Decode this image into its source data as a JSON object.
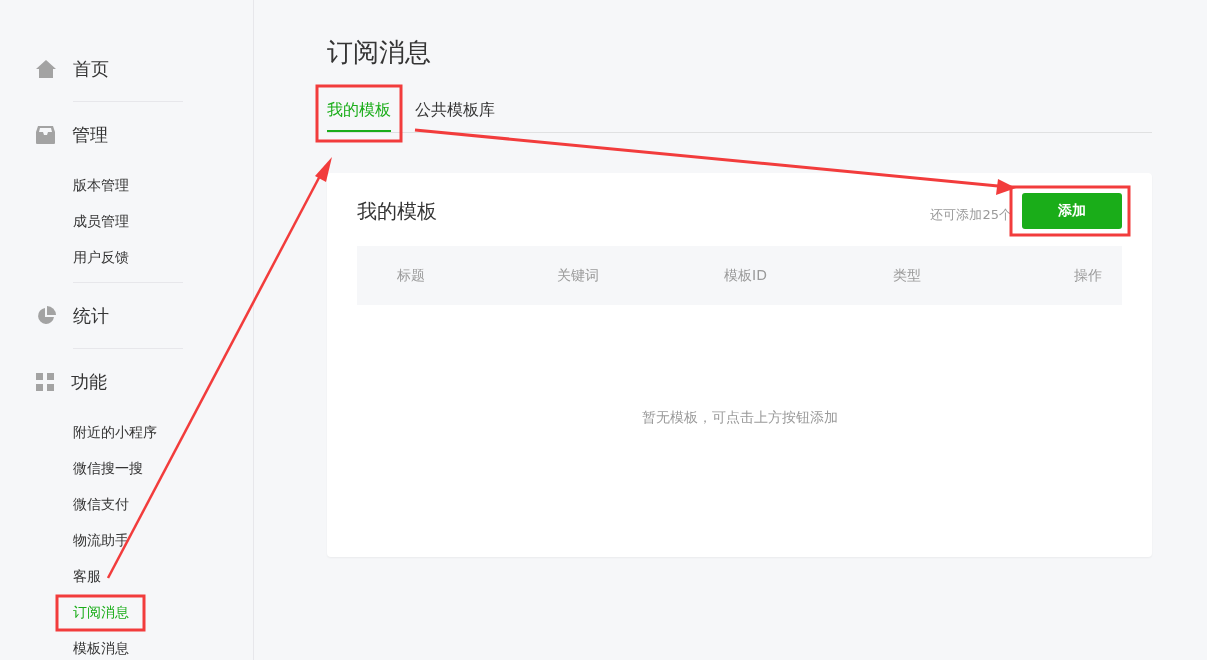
{
  "sidebar": {
    "groups": [
      {
        "kind": "home",
        "label": "首页"
      },
      {
        "kind": "inbox",
        "label": "管理",
        "children": [
          {
            "label": "版本管理",
            "selected": false
          },
          {
            "label": "成员管理",
            "selected": false
          },
          {
            "label": "用户反馈",
            "selected": false
          }
        ]
      },
      {
        "kind": "pie",
        "label": "统计"
      },
      {
        "kind": "grid",
        "label": "功能",
        "children": [
          {
            "label": "附近的小程序",
            "selected": false
          },
          {
            "label": "微信搜一搜",
            "selected": false
          },
          {
            "label": "微信支付",
            "selected": false
          },
          {
            "label": "物流助手",
            "selected": false
          },
          {
            "label": "客服",
            "selected": false
          },
          {
            "label": "订阅消息",
            "selected": true
          },
          {
            "label": "模板消息",
            "selected": false
          }
        ]
      }
    ]
  },
  "page": {
    "title": "订阅消息",
    "tabs": [
      {
        "label": "我的模板",
        "selected": true
      },
      {
        "label": "公共模板库",
        "selected": false
      }
    ],
    "card": {
      "title": "我的模板",
      "quota": "还可添加25个",
      "add_button": "添加",
      "columns": [
        "标题",
        "关键词",
        "模板ID",
        "类型",
        "操作"
      ],
      "empty_text": "暂无模板，可点击上方按钮添加"
    }
  }
}
